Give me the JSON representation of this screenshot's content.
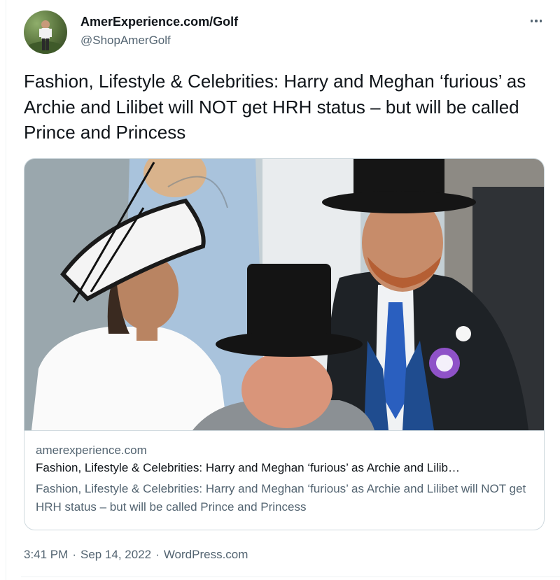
{
  "author": {
    "display_name": "AmerExperience.com/Golf",
    "handle": "@ShopAmerGolf"
  },
  "more_icon": "more-horizontal-icon",
  "tweet": {
    "text": "Fashion, Lifestyle & Celebrities: Harry and Meghan ‘furious’ as Archie and Lilibet will NOT get HRH status – but will be called Prince and Princess"
  },
  "card": {
    "domain": "amerexperience.com",
    "title": "Fashion, Lifestyle & Celebrities: Harry and Meghan ‘furious’ as Archie and Lilib…",
    "description": "Fashion, Lifestyle & Celebrities: Harry and Meghan ‘furious’ as Archie and Lilibet will NOT get HRH status – but will be called Prince and Princess"
  },
  "meta": {
    "time": "3:41 PM",
    "separator": "·",
    "date": "Sep 14, 2022",
    "source": "WordPress.com"
  },
  "colors": {
    "text_primary": "#0f1419",
    "text_secondary": "#536471",
    "border": "#cfd9de"
  }
}
